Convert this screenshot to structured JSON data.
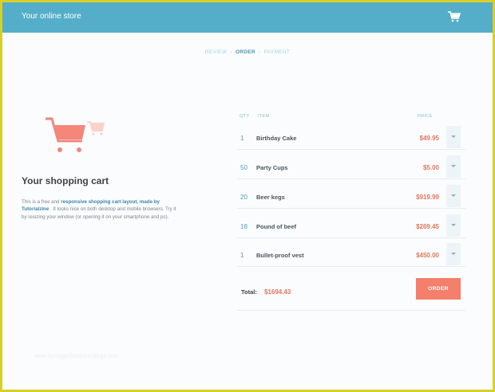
{
  "app": {
    "title": "Your online store",
    "cart_icon": "shopping-cart-icon"
  },
  "steps": [
    {
      "label": "REVIEW",
      "active": false
    },
    {
      "label": "ORDER",
      "active": true
    },
    {
      "label": "PAYMENT",
      "active": false
    }
  ],
  "steps_separator": "›",
  "left": {
    "illustration": "shopping-cart-illustration",
    "title": "Your shopping cart",
    "desc_prefix": "This is a free and ",
    "desc_link": "responsive shopping cart layout, made by Tutorialzine",
    "desc_suffix": ". It looks nice on both desktop and mobile browsers. Try it by resizing your window (or opening it on your smartphone and pc)."
  },
  "table": {
    "headers": {
      "qty": "QTY",
      "item": "ITEM",
      "price": "PRICE"
    },
    "rows": [
      {
        "qty": "1",
        "item": "Birthday Cake",
        "price": "$49.95"
      },
      {
        "qty": "50",
        "item": "Party Cups",
        "price": "$5.00"
      },
      {
        "qty": "20",
        "item": "Beer kegs",
        "price": "$919.99"
      },
      {
        "qty": "18",
        "item": "Pound of beef",
        "price": "$269.45"
      },
      {
        "qty": "1",
        "item": "Bullet-proof vest",
        "price": "$450.00"
      }
    ]
  },
  "summary": {
    "total_label": "Total:",
    "total_value": "$1694.43",
    "order_button": "ORDER"
  },
  "watermark": "www.heritagechristiancollege.com",
  "colors": {
    "header": "#55aec9",
    "accent": "#f47f6b",
    "link": "#3e84ab",
    "border": "#d8cf2d"
  }
}
